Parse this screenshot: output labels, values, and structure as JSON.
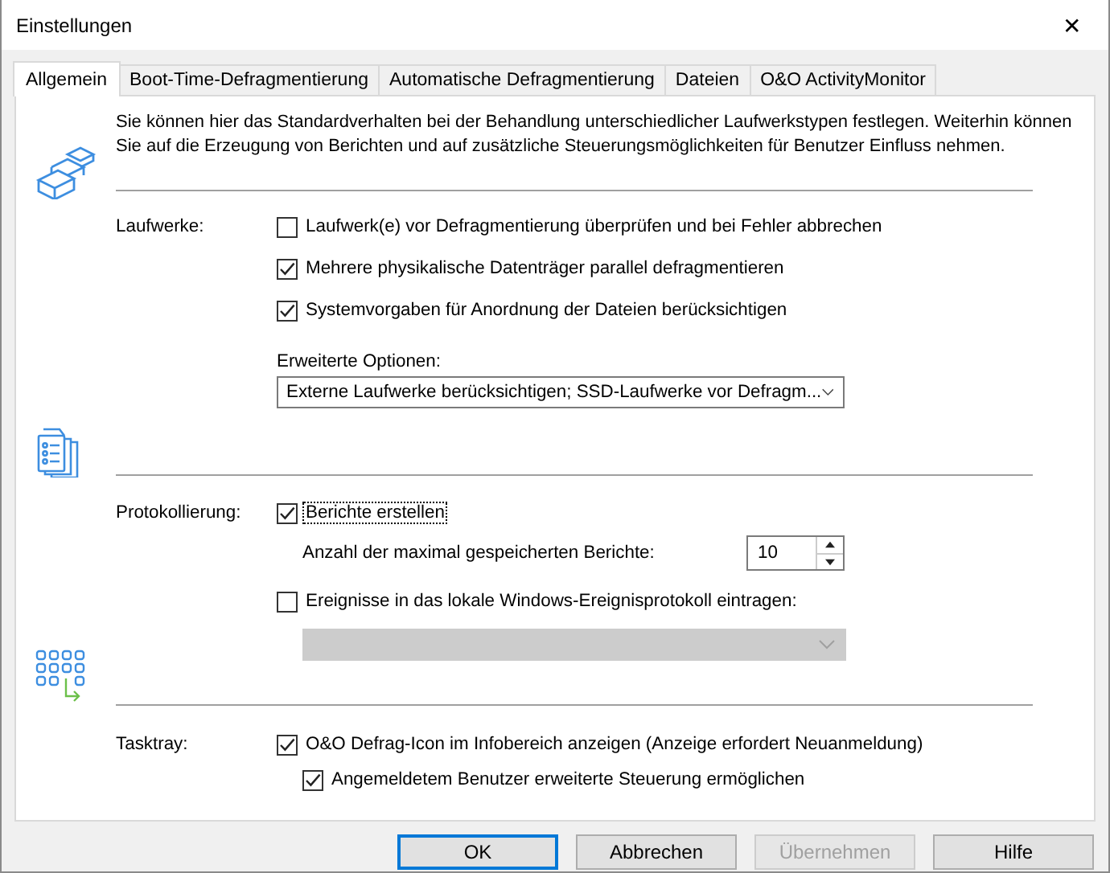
{
  "window": {
    "title": "Einstellungen",
    "close": "✕"
  },
  "tabs": [
    {
      "label": "Allgemein",
      "selected": true
    },
    {
      "label": "Boot-Time-Defragmentierung",
      "selected": false
    },
    {
      "label": "Automatische Defragmentierung",
      "selected": false
    },
    {
      "label": "Dateien",
      "selected": false
    },
    {
      "label": "O&O ActivityMonitor",
      "selected": false
    }
  ],
  "description": "Sie können hier das Standardverhalten bei der Behandlung unterschiedlicher Laufwerkstypen festlegen. Weiterhin können Sie auf die Erzeugung von Berichten und auf zusätzliche Steuerungsmöglichkeiten für Benutzer Einfluss nehmen.",
  "sections": [
    {
      "label": "Laufwerke:",
      "items": [
        {
          "kind": "checkbox",
          "label": "Laufwerk(e) vor Defragmentierung überprüfen und bei Fehler abbrechen",
          "checked": false,
          "focused": false
        },
        {
          "kind": "checkbox",
          "label": "Mehrere physikalische Datenträger parallel defragmentieren",
          "checked": true,
          "focused": false
        },
        {
          "kind": "checkbox",
          "label": "Systemvorgaben für Anordnung der Dateien berücksichtigen",
          "checked": true,
          "focused": false
        },
        {
          "kind": "dropdown",
          "caption": "Erweiterte Optionen:",
          "value": "Externe Laufwerke berücksichtigen; SSD-Laufwerke vor Defragm...",
          "disabled": false
        }
      ]
    },
    {
      "label": "Protokollierung:",
      "items": [
        {
          "kind": "checkbox",
          "label": "Berichte erstellen",
          "checked": true,
          "focused": true
        },
        {
          "kind": "spinner",
          "label": "Anzahl der maximal gespeicherten Berichte:",
          "value": "10"
        },
        {
          "kind": "checkbox",
          "label": "Ereignisse in das lokale Windows-Ereignisprotokoll eintragen:",
          "checked": false,
          "focused": false
        },
        {
          "kind": "dropdown",
          "disabled": true
        }
      ]
    },
    {
      "label": "Tasktray:",
      "items": [
        {
          "kind": "checkbox",
          "label": "O&O Defrag-Icon im Infobereich anzeigen (Anzeige erfordert Neuanmeldung)",
          "checked": true,
          "focused": false,
          "children": [
            {
              "kind": "checkbox",
              "label": "Angemeldetem Benutzer erweiterte Steuerung ermöglichen",
              "checked": true,
              "focused": false
            }
          ]
        }
      ]
    }
  ],
  "buttons": [
    {
      "label": "OK",
      "default": true,
      "disabled": false
    },
    {
      "label": "Abbrechen",
      "default": false,
      "disabled": false
    },
    {
      "label": "Übernehmen",
      "default": false,
      "disabled": true
    },
    {
      "label": "Hilfe",
      "default": false,
      "disabled": false
    }
  ]
}
